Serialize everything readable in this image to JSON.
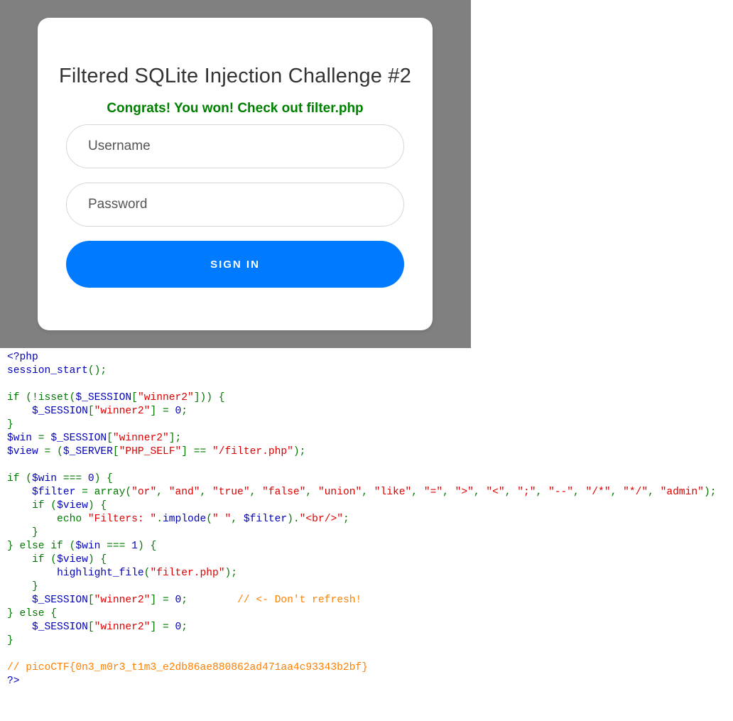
{
  "login": {
    "title": "Filtered SQLite Injection Challenge #2",
    "message": "Congrats! You won! Check out filter.php",
    "username_placeholder": "Username",
    "password_placeholder": "Password",
    "signin_label": "SIGN IN"
  },
  "colors": {
    "background_gray": "#808080",
    "message_green": "#008000",
    "button_blue": "#007bff",
    "code_default": "#0000BB",
    "code_keyword": "#007700",
    "code_string": "#DD0000",
    "code_comment": "#FF8000"
  },
  "code_lines": [
    [
      {
        "t": "<?php",
        "c": "d"
      }
    ],
    [
      {
        "t": "session_start",
        "c": "d"
      },
      {
        "t": "();",
        "c": "k"
      }
    ],
    [],
    [
      {
        "t": "if (!isset(",
        "c": "k"
      },
      {
        "t": "$_SESSION",
        "c": "d"
      },
      {
        "t": "[",
        "c": "k"
      },
      {
        "t": "\"winner2\"",
        "c": "s"
      },
      {
        "t": "])) {",
        "c": "k"
      }
    ],
    [
      {
        "t": "    ",
        "c": "d"
      },
      {
        "t": "$_SESSION",
        "c": "d"
      },
      {
        "t": "[",
        "c": "k"
      },
      {
        "t": "\"winner2\"",
        "c": "s"
      },
      {
        "t": "] = ",
        "c": "k"
      },
      {
        "t": "0",
        "c": "d"
      },
      {
        "t": ";",
        "c": "k"
      }
    ],
    [
      {
        "t": "}",
        "c": "k"
      }
    ],
    [
      {
        "t": "$win",
        "c": "d"
      },
      {
        "t": " = ",
        "c": "k"
      },
      {
        "t": "$_SESSION",
        "c": "d"
      },
      {
        "t": "[",
        "c": "k"
      },
      {
        "t": "\"winner2\"",
        "c": "s"
      },
      {
        "t": "];",
        "c": "k"
      }
    ],
    [
      {
        "t": "$view",
        "c": "d"
      },
      {
        "t": " = (",
        "c": "k"
      },
      {
        "t": "$_SERVER",
        "c": "d"
      },
      {
        "t": "[",
        "c": "k"
      },
      {
        "t": "\"PHP_SELF\"",
        "c": "s"
      },
      {
        "t": "] == ",
        "c": "k"
      },
      {
        "t": "\"/filter.php\"",
        "c": "s"
      },
      {
        "t": ");",
        "c": "k"
      }
    ],
    [],
    [
      {
        "t": "if (",
        "c": "k"
      },
      {
        "t": "$win",
        "c": "d"
      },
      {
        "t": " === ",
        "c": "k"
      },
      {
        "t": "0",
        "c": "d"
      },
      {
        "t": ") {",
        "c": "k"
      }
    ],
    [
      {
        "t": "    ",
        "c": "d"
      },
      {
        "t": "$filter",
        "c": "d"
      },
      {
        "t": " = array(",
        "c": "k"
      },
      {
        "t": "\"or\"",
        "c": "s"
      },
      {
        "t": ", ",
        "c": "k"
      },
      {
        "t": "\"and\"",
        "c": "s"
      },
      {
        "t": ", ",
        "c": "k"
      },
      {
        "t": "\"true\"",
        "c": "s"
      },
      {
        "t": ", ",
        "c": "k"
      },
      {
        "t": "\"false\"",
        "c": "s"
      },
      {
        "t": ", ",
        "c": "k"
      },
      {
        "t": "\"union\"",
        "c": "s"
      },
      {
        "t": ", ",
        "c": "k"
      },
      {
        "t": "\"like\"",
        "c": "s"
      },
      {
        "t": ", ",
        "c": "k"
      },
      {
        "t": "\"=\"",
        "c": "s"
      },
      {
        "t": ", ",
        "c": "k"
      },
      {
        "t": "\">\"",
        "c": "s"
      },
      {
        "t": ", ",
        "c": "k"
      },
      {
        "t": "\"<\"",
        "c": "s"
      },
      {
        "t": ", ",
        "c": "k"
      },
      {
        "t": "\";\"",
        "c": "s"
      },
      {
        "t": ", ",
        "c": "k"
      },
      {
        "t": "\"--\"",
        "c": "s"
      },
      {
        "t": ", ",
        "c": "k"
      },
      {
        "t": "\"/*\"",
        "c": "s"
      },
      {
        "t": ", ",
        "c": "k"
      },
      {
        "t": "\"*/\"",
        "c": "s"
      },
      {
        "t": ", ",
        "c": "k"
      },
      {
        "t": "\"admin\"",
        "c": "s"
      },
      {
        "t": ");",
        "c": "k"
      }
    ],
    [
      {
        "t": "    if (",
        "c": "k"
      },
      {
        "t": "$view",
        "c": "d"
      },
      {
        "t": ") {",
        "c": "k"
      }
    ],
    [
      {
        "t": "        echo ",
        "c": "k"
      },
      {
        "t": "\"Filters: \"",
        "c": "s"
      },
      {
        "t": ".",
        "c": "k"
      },
      {
        "t": "implode",
        "c": "d"
      },
      {
        "t": "(",
        "c": "k"
      },
      {
        "t": "\" \"",
        "c": "s"
      },
      {
        "t": ", ",
        "c": "k"
      },
      {
        "t": "$filter",
        "c": "d"
      },
      {
        "t": ").",
        "c": "k"
      },
      {
        "t": "\"<br/>\"",
        "c": "s"
      },
      {
        "t": ";",
        "c": "k"
      }
    ],
    [
      {
        "t": "    }",
        "c": "k"
      }
    ],
    [
      {
        "t": "} else if (",
        "c": "k"
      },
      {
        "t": "$win",
        "c": "d"
      },
      {
        "t": " === ",
        "c": "k"
      },
      {
        "t": "1",
        "c": "d"
      },
      {
        "t": ") {",
        "c": "k"
      }
    ],
    [
      {
        "t": "    if (",
        "c": "k"
      },
      {
        "t": "$view",
        "c": "d"
      },
      {
        "t": ") {",
        "c": "k"
      }
    ],
    [
      {
        "t": "        ",
        "c": "d"
      },
      {
        "t": "highlight_file",
        "c": "d"
      },
      {
        "t": "(",
        "c": "k"
      },
      {
        "t": "\"filter.php\"",
        "c": "s"
      },
      {
        "t": ");",
        "c": "k"
      }
    ],
    [
      {
        "t": "    }",
        "c": "k"
      }
    ],
    [
      {
        "t": "    ",
        "c": "d"
      },
      {
        "t": "$_SESSION",
        "c": "d"
      },
      {
        "t": "[",
        "c": "k"
      },
      {
        "t": "\"winner2\"",
        "c": "s"
      },
      {
        "t": "] = ",
        "c": "k"
      },
      {
        "t": "0",
        "c": "d"
      },
      {
        "t": ";        ",
        "c": "k"
      },
      {
        "t": "// <- Don't refresh!",
        "c": "c"
      }
    ],
    [
      {
        "t": "} else {",
        "c": "k"
      }
    ],
    [
      {
        "t": "    ",
        "c": "d"
      },
      {
        "t": "$_SESSION",
        "c": "d"
      },
      {
        "t": "[",
        "c": "k"
      },
      {
        "t": "\"winner2\"",
        "c": "s"
      },
      {
        "t": "] = ",
        "c": "k"
      },
      {
        "t": "0",
        "c": "d"
      },
      {
        "t": ";",
        "c": "k"
      }
    ],
    [
      {
        "t": "}",
        "c": "k"
      }
    ],
    [],
    [
      {
        "t": "// picoCTF{0n3_m0r3_t1m3_e2db86ae880862ad471aa4c93343b2bf}",
        "c": "c"
      }
    ],
    [
      {
        "t": "?>",
        "c": "d"
      }
    ]
  ]
}
